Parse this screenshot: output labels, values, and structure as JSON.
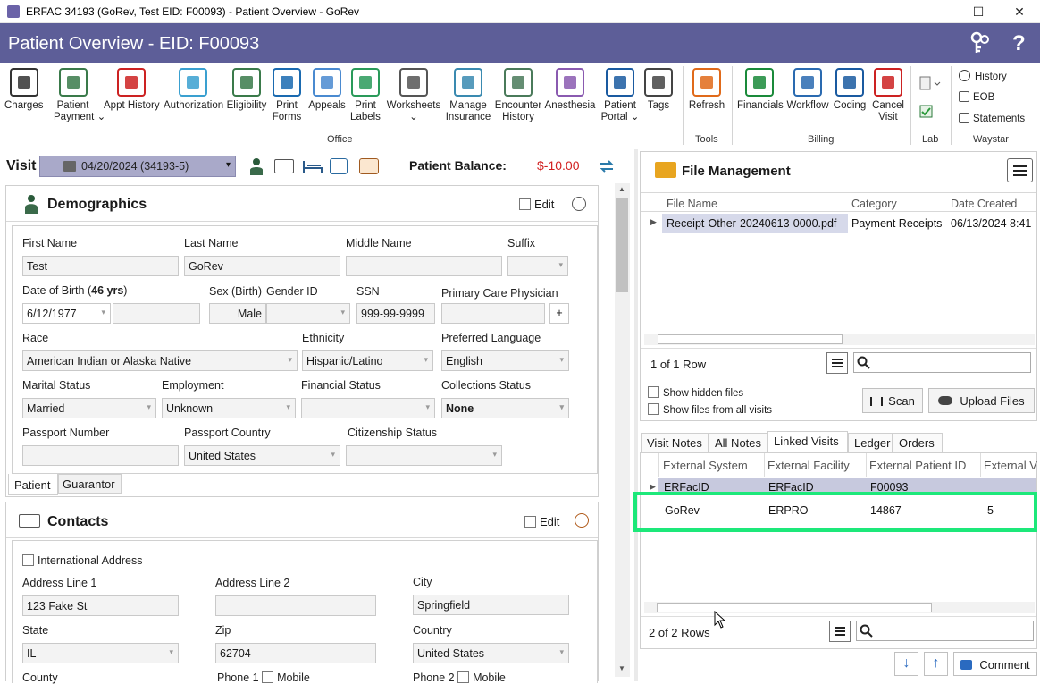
{
  "window": {
    "title": "ERFAC 34193 (GoRev, Test EID: F00093) - Patient Overview - GoRev",
    "minimize": "—",
    "maximize": "☐",
    "close": "✕"
  },
  "header": {
    "title": "Patient Overview - EID: F00093",
    "help": "?"
  },
  "ribbon": {
    "buttons": [
      {
        "label": "Charges",
        "icon": "barcode-icon"
      },
      {
        "label": "Patient",
        "label2": "Payment ⌄",
        "icon": "patient-payment-icon"
      },
      {
        "label": "Appt History",
        "icon": "calendar-icon"
      },
      {
        "label": "Authorization",
        "icon": "shield-check-icon"
      },
      {
        "label": "Eligibility",
        "icon": "person-check-icon"
      },
      {
        "label": "Print",
        "label2": "Forms",
        "icon": "printer-icon"
      },
      {
        "label": "Appeals",
        "icon": "documents-icon"
      },
      {
        "label": "Print",
        "label2": "Labels",
        "icon": "tag-icon"
      },
      {
        "label": "Worksheets",
        "label2": "⌄",
        "icon": "worksheet-icon"
      },
      {
        "label": "Manage",
        "label2": "Insurance",
        "icon": "insurance-shield-icon"
      },
      {
        "label": "Encounter",
        "label2": "History",
        "icon": "encounter-history-icon"
      },
      {
        "label": "Anesthesia",
        "icon": "syringe-icon"
      },
      {
        "label": "Patient",
        "label2": "Portal ⌄",
        "icon": "globe-gear-icon"
      },
      {
        "label": "Tags",
        "icon": "tags-search-icon"
      },
      {
        "label": "Refresh",
        "icon": "refresh-icon"
      },
      {
        "label": "Financials",
        "icon": "dollar-icon"
      },
      {
        "label": "Workflow",
        "icon": "clipboard-icon"
      },
      {
        "label": "Coding",
        "icon": "coding-icon"
      },
      {
        "label": "Cancel",
        "label2": "Visit",
        "icon": "cancel-clock-icon"
      }
    ],
    "groups": {
      "office": "Office",
      "tools": "Tools",
      "billing": "Billing",
      "lab": "Lab",
      "waystar": "Waystar"
    },
    "waystar_items": [
      "History",
      "EOB",
      "Statements"
    ]
  },
  "visit": {
    "label": "Visit",
    "selected": "04/20/2024 (34193-5)",
    "balance_label": "Patient Balance:",
    "balance_value": "$-10.00"
  },
  "demographics": {
    "title": "Demographics",
    "edit": "Edit",
    "labels": {
      "first_name": "First Name",
      "last_name": "Last Name",
      "middle_name": "Middle Name",
      "suffix": "Suffix",
      "dob_prefix": "Date of Birth (",
      "dob_age": "46 yrs",
      "dob_suffix": ")",
      "sex": "Sex (Birth)",
      "gender": "Gender ID",
      "ssn": "SSN",
      "pcp": "Primary Care Physician",
      "race": "Race",
      "ethnicity": "Ethnicity",
      "language": "Preferred Language",
      "marital": "Marital Status",
      "employment": "Employment",
      "financial": "Financial Status",
      "collections": "Collections Status",
      "passport": "Passport Number",
      "passport_country": "Passport Country",
      "citizenship": "Citizenship Status"
    },
    "values": {
      "first_name": "Test",
      "last_name": "GoRev",
      "middle_name": "",
      "suffix": "",
      "dob": "6/12/1977",
      "sex": "Male",
      "ssn": "999-99-9999",
      "pcp_add": "+",
      "race": "American Indian or Alaska Native",
      "ethnicity": "Hispanic/Latino",
      "language": "English",
      "marital": "Married",
      "employment": "Unknown",
      "financial": "",
      "collections": "None",
      "passport": "",
      "passport_country": "United States",
      "citizenship": ""
    },
    "tabs": [
      "Patient",
      "Guarantor"
    ]
  },
  "contacts": {
    "title": "Contacts",
    "edit": "Edit",
    "international": "International Address",
    "labels": {
      "addr1": "Address Line 1",
      "addr2": "Address Line 2",
      "city": "City",
      "state": "State",
      "zip": "Zip",
      "country": "Country",
      "county": "County",
      "phone1": "Phone 1",
      "phone2": "Phone 2",
      "mobile": "Mobile"
    },
    "values": {
      "addr1": "123 Fake St",
      "addr2": "",
      "city": "Springfield",
      "state": "IL",
      "zip": "62704",
      "country": "United States"
    }
  },
  "file_management": {
    "title": "File Management",
    "columns": [
      "File Name",
      "Category",
      "Date Created"
    ],
    "rows": [
      {
        "name": "Receipt-Other-20240613-0000.pdf",
        "category": "Payment Receipts",
        "date": "06/13/2024 8:41"
      }
    ],
    "row_count": "1 of 1 Row",
    "show_hidden": "Show hidden files",
    "show_all": "Show files from all visits",
    "scan": "Scan",
    "upload": "Upload Files"
  },
  "linked": {
    "tabs": [
      "Visit Notes",
      "All Notes",
      "Linked Visits",
      "Ledger",
      "Orders"
    ],
    "columns": [
      "External System",
      "External Facility",
      "External Patient ID",
      "External V"
    ],
    "rows": [
      {
        "system": "ERFacID",
        "facility": "ERFacID",
        "pid": "F00093",
        "v": ""
      },
      {
        "system": "GoRev",
        "facility": "ERPRO",
        "pid": "14867",
        "v": "5"
      }
    ],
    "row_count": "2 of 2 Rows",
    "comment": "Comment"
  },
  "colors": {
    "header": "#5d5e98",
    "highlight": "#1de87a",
    "balance": "#d11f1f"
  }
}
